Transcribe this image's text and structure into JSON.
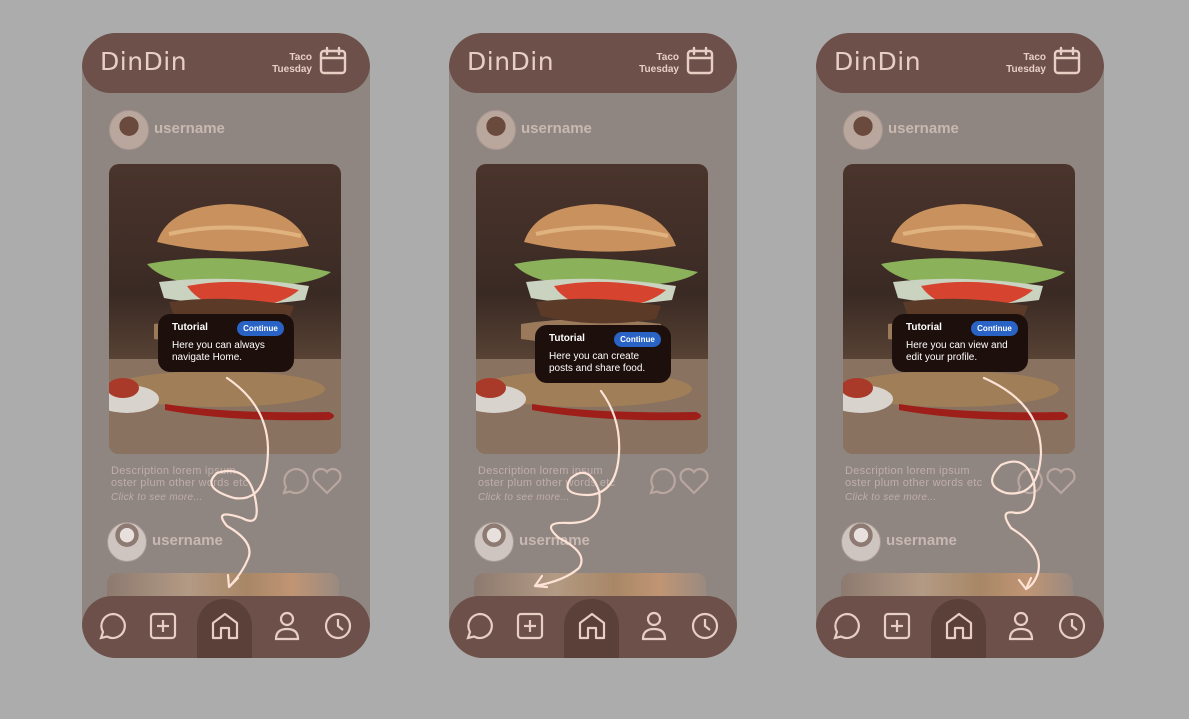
{
  "app": {
    "logo": "DinDin",
    "day_line1": "Taco",
    "day_line2": "Tuesday"
  },
  "feed": {
    "post1_username": "username",
    "post2_username": "username",
    "description_line1": "Description lorem ipsum",
    "description_line2": "oster plum other words etc",
    "click_more": "Click to see more..."
  },
  "tutorial": {
    "title": "Tutorial",
    "continue_label": "Continue",
    "steps": [
      {
        "text": "Here you can always navigate Home.",
        "points_to": "home"
      },
      {
        "text": "Here you can create posts and share food.",
        "points_to": "create"
      },
      {
        "text": "Here you can view and edit your profile.",
        "points_to": "profile"
      }
    ]
  },
  "navbar": {
    "items": [
      "chat-icon",
      "add-icon",
      "home-icon",
      "user-icon",
      "clock-icon"
    ],
    "active": "home"
  },
  "colors": {
    "background": "#acacac",
    "overlay": "#908681",
    "bar": "#6d5049",
    "text_light": "#e7cfc6",
    "tooltip": "#1d0f0c",
    "button": "#2863c5",
    "arrow": "#fde2d6"
  }
}
